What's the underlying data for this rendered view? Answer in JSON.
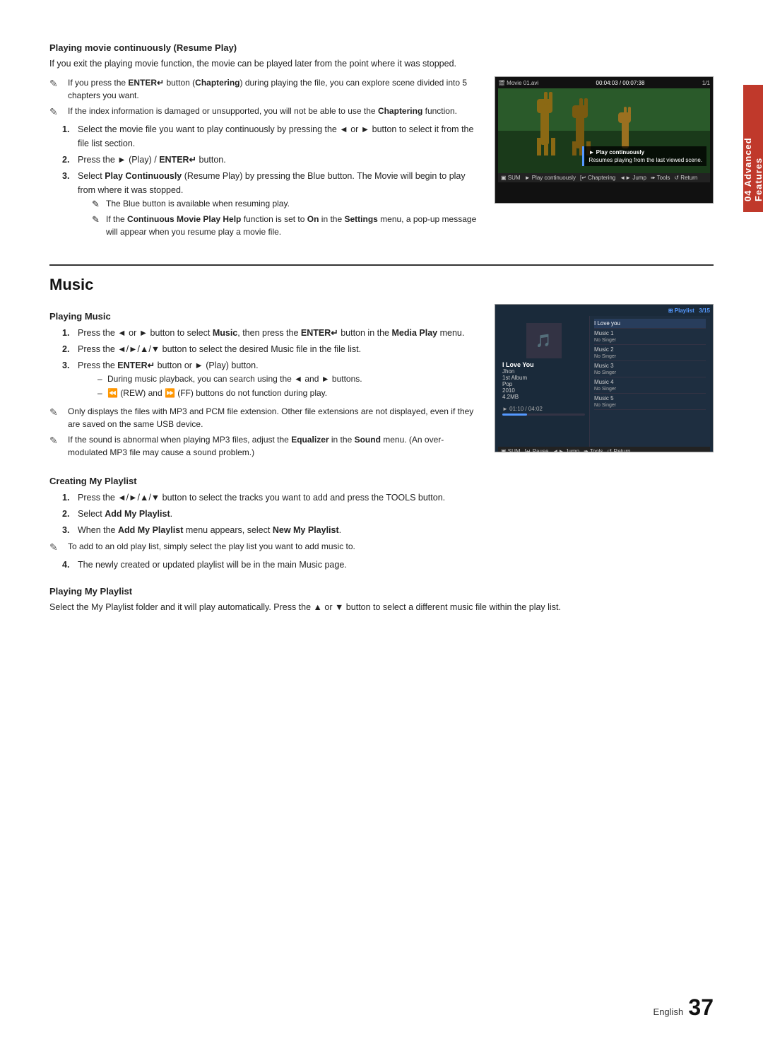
{
  "side_tab": {
    "label": "04 Advanced Features"
  },
  "resume_section": {
    "title": "Playing movie continuously (Resume Play)",
    "intro": "If you exit the playing movie function, the movie can be played later from the point where it was stopped.",
    "notes": [
      "If you press the ENTER↵ button (Chaptering) during playing the file, you can explore scene divided into 5 chapters you want.",
      "If the index information is damaged or unsupported, you will not be able to use the Chaptering function."
    ],
    "steps": [
      {
        "num": "1.",
        "text": "Select the movie file you want to play continuously by pressing the ◄ or ► button to select it from the file list section."
      },
      {
        "num": "2.",
        "text": "Press the ► (Play) / ENTER↵ button."
      },
      {
        "num": "3.",
        "text": "Select Play Continuously (Resume Play) by pressing the Blue button. The Movie will begin to play from where it was stopped.",
        "sub_notes": [
          "The Blue button is available when resuming play.",
          "If the Continuous Movie Play Help function is set to On in the Settings menu, a pop-up message will appear when you resume play a movie file."
        ]
      }
    ],
    "screenshot": {
      "header_text": "00:04:03 / 00:07:38",
      "filename": "Movie 01.avi",
      "counter": "1/1",
      "dialog_title": "► Play continuously",
      "dialog_text": "Resumes playing from the last viewed scene.",
      "toolbar_items": [
        "▣ SUM",
        "► Play continuously",
        "[↵ Chaptering",
        "◄► Jump",
        "➠ Tools",
        "↺ Return"
      ]
    }
  },
  "music_section": {
    "title": "Music",
    "playing_music": {
      "subtitle": "Playing Music",
      "steps": [
        {
          "num": "1.",
          "text": "Press the ◄ or ► button to select Music, then press the ENTER↵ button in the Media Play menu."
        },
        {
          "num": "2.",
          "text": "Press the ◄/►/▲/▼ button to select the desired Music file in the file list."
        },
        {
          "num": "3.",
          "text": "Press the ENTER↵ button or ► (Play) button.",
          "dash_notes": [
            "During music playback, you can search using the ◄ and ► buttons.",
            "⏪ (REW) and ⏩ (FF) buttons do not function during play."
          ]
        }
      ],
      "notes": [
        "Only displays the files with MP3 and PCM file extension. Other file extensions are not displayed, even if they are saved on the same USB device.",
        "If the sound is abnormal when playing MP3 files, adjust the Equalizer in the Sound menu. (An over-modulated MP3 file may cause a sound problem.)"
      ]
    },
    "screenshot": {
      "playlist_label": "Playlist",
      "counter": "3/15",
      "song_title": "I Love You",
      "artist": "Jhon",
      "album": "1st Album",
      "genre": "Pop",
      "year": "2010",
      "size": "4.2MB",
      "progress": "01:10 / 04:02",
      "playlist_items": [
        {
          "name": "I Love you",
          "sub": ""
        },
        {
          "name": "Music 1",
          "sub": "No Singer"
        },
        {
          "name": "Music 2",
          "sub": "No Singer"
        },
        {
          "name": "Music 3",
          "sub": "No Singer"
        },
        {
          "name": "Music 4",
          "sub": "No Singer"
        },
        {
          "name": "Music 5",
          "sub": "No Singer"
        }
      ],
      "toolbar_items": [
        "▣ SUM",
        "[↵ Pause",
        "◄► Jump",
        "➠ Tools",
        "↺ Return"
      ]
    },
    "creating_playlist": {
      "subtitle": "Creating My Playlist",
      "steps": [
        {
          "num": "1.",
          "text": "Press the ◄/►/▲/▼ button to select the tracks you want to add and press the TOOLS button."
        },
        {
          "num": "2.",
          "text": "Select Add My Playlist."
        },
        {
          "num": "3.",
          "text": "When the Add My Playlist menu appears, select New My Playlist."
        }
      ],
      "notes": [
        "To add to an old play list, simply select the play list you want to add music to.",
        "The newly created or updated playlist will be in the main Music page."
      ]
    },
    "playing_playlist": {
      "subtitle": "Playing My Playlist",
      "text": "Select the My Playlist folder and it will play automatically. Press the ▲ or ▼ button to select a different music file within the play list."
    }
  },
  "footer": {
    "english_label": "English",
    "page_number": "37"
  }
}
